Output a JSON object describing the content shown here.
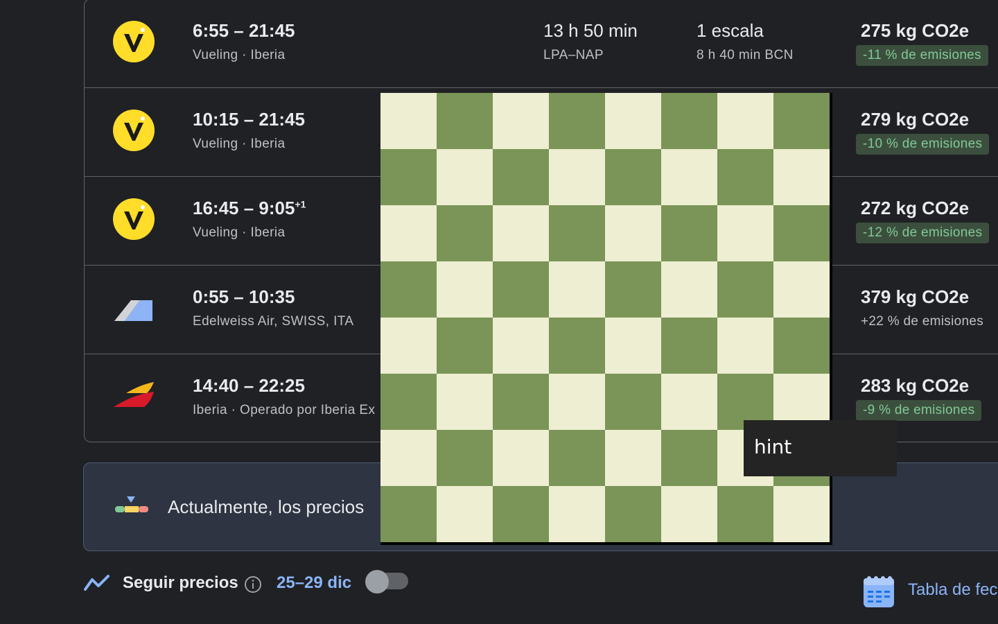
{
  "flights": [
    {
      "time": "6:55 – 21:45",
      "time_suffix": "",
      "airline": "Vueling · Iberia",
      "duration": "13 h 50 min",
      "route": "LPA–NAP",
      "stops": "1 escala",
      "layover": "8 h 40 min BCN",
      "co2": "275 kg CO2e",
      "emissions": "-11 % de emisiones",
      "logo": "vueling-logo"
    },
    {
      "time": "10:15 – 21:45",
      "time_suffix": "",
      "airline": "Vueling · Iberia",
      "co2": "279 kg CO2e",
      "emissions": "-10 % de emisiones",
      "logo": "vueling-logo"
    },
    {
      "time": "16:45 – 9:05",
      "time_suffix": "+1",
      "airline": "Vueling · Iberia",
      "co2": "272 kg CO2e",
      "emissions": "-12 % de emisiones",
      "logo": "vueling-logo"
    },
    {
      "time": "0:55 – 10:35",
      "time_suffix": "",
      "airline": "Edelweiss Air, SWISS, ITA",
      "co2": "379 kg CO2e",
      "emissions": "+22 % de emisiones",
      "logo": "edelweiss-logo"
    },
    {
      "time": "14:40 – 22:25",
      "time_suffix": "",
      "airline": "Iberia · Operado por Iberia Ex",
      "co2": "283 kg CO2e",
      "emissions": "-9 % de emisiones",
      "logo": "iberia-logo"
    }
  ],
  "insight": {
    "text": "Actualmente, los precios"
  },
  "footer": {
    "track_label": "Seguir precios",
    "dates": "25–29 dic",
    "calendar_label": "Tabla de fec"
  },
  "overlay": {
    "hint_label": "hint"
  },
  "colors": {
    "background": "#202124",
    "board_light": "#eeeed2",
    "board_dark": "#7a9557",
    "accent_blue": "#8ab4f8",
    "emission_green": "#81c995"
  }
}
